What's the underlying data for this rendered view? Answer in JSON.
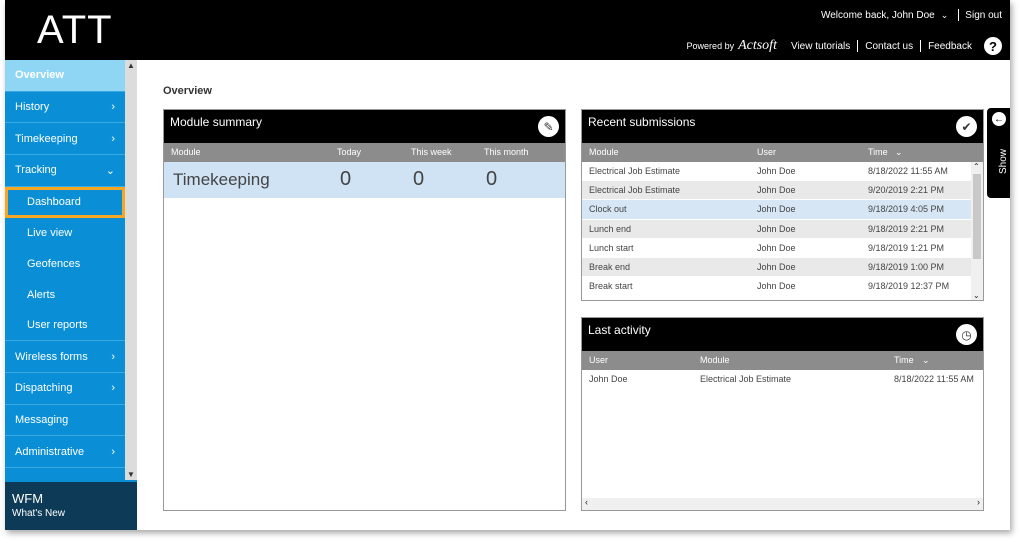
{
  "header": {
    "logo": "ATT",
    "welcome": "Welcome back, John Doe",
    "sign_out": "Sign out",
    "powered_by": "Powered by",
    "brand": "Actsoft",
    "view_tutorials": "View tutorials",
    "contact_us": "Contact us",
    "feedback": "Feedback",
    "help": "?"
  },
  "sidebar": {
    "items": [
      {
        "label": "Overview"
      },
      {
        "label": "History"
      },
      {
        "label": "Timekeeping"
      },
      {
        "label": "Tracking"
      },
      {
        "label": "Dashboard"
      },
      {
        "label": "Live view"
      },
      {
        "label": "Geofences"
      },
      {
        "label": "Alerts"
      },
      {
        "label": "User reports"
      },
      {
        "label": "Wireless forms"
      },
      {
        "label": "Dispatching"
      },
      {
        "label": "Messaging"
      },
      {
        "label": "Administrative"
      }
    ],
    "footer_title": "WFM",
    "footer_sub": "What's New"
  },
  "main": {
    "title": "Overview",
    "show_tab": "Show"
  },
  "module_summary": {
    "title": "Module summary",
    "columns": [
      "Module",
      "Today",
      "This week",
      "This month"
    ],
    "rows": [
      {
        "module": "Timekeeping",
        "today": "0",
        "week": "0",
        "month": "0"
      }
    ]
  },
  "recent_submissions": {
    "title": "Recent submissions",
    "columns": [
      "Module",
      "User",
      "Time"
    ],
    "rows": [
      {
        "module": "Electrical Job Estimate",
        "user": "John Doe",
        "time": "8/18/2022 11:55 AM"
      },
      {
        "module": "Electrical Job Estimate",
        "user": "John Doe",
        "time": "9/20/2019 2:21 PM"
      },
      {
        "module": "Clock out",
        "user": "John Doe",
        "time": "9/18/2019 4:05 PM"
      },
      {
        "module": "Lunch end",
        "user": "John Doe",
        "time": "9/18/2019 2:21 PM"
      },
      {
        "module": "Lunch start",
        "user": "John Doe",
        "time": "9/18/2019 1:21 PM"
      },
      {
        "module": "Break end",
        "user": "John Doe",
        "time": "9/18/2019 1:00 PM"
      },
      {
        "module": "Break start",
        "user": "John Doe",
        "time": "9/18/2019 12:37 PM"
      }
    ]
  },
  "last_activity": {
    "title": "Last activity",
    "columns": [
      "User",
      "Module",
      "Time"
    ],
    "rows": [
      {
        "user": "John Doe",
        "module": "Electrical Job Estimate",
        "time": "8/18/2022 11:55 AM"
      }
    ]
  },
  "colors": {
    "sidebar": "#0a8fd6",
    "sidebar_active": "#8fd6f5",
    "highlight": "#f5a623",
    "header": "#000000"
  }
}
